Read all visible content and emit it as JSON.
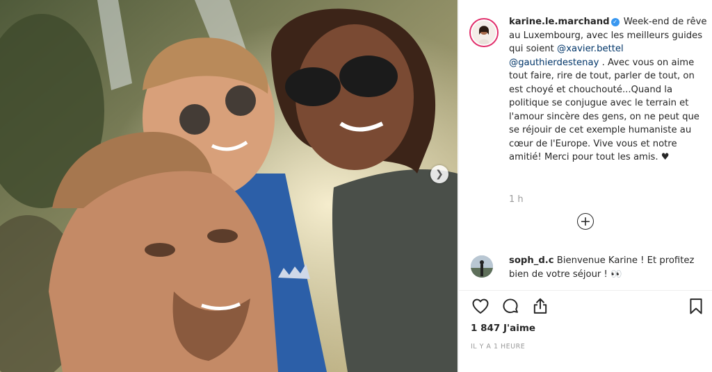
{
  "post": {
    "username": "karine.le.marchand",
    "caption_start": " Week-end de rêve au Luxembourg, avec les meilleurs guides qui soient ",
    "mention_1": "@xavier.bettel",
    "mention_2": "@gauthierdestenay",
    "caption_end": " . Avec vous on aime tout faire, rire de tout, parler de tout, on est choyé et chouchouté...Quand la politique se conjugue avec le terrain et l'amour sincère des gens, on ne peut que se réjouir de cet exemple humaniste au cœur de l'Europe. Vive vous et notre amitié! Merci pour tout les amis. ♥",
    "caption_time": "1 h",
    "likes": "1 847 J'aime",
    "posted_ago": "IL Y A 1 HEURE"
  },
  "comment": {
    "username": "soph_d.c",
    "text": " Bienvenue Karine ! Et profitez bien de votre séjour ! 👀"
  },
  "icons": {
    "verified": "verified-badge-icon",
    "load_more": "plus-circle-icon",
    "like": "heart-icon",
    "comment": "comment-bubble-icon",
    "share": "share-icon",
    "save": "bookmark-icon",
    "next": "chevron-right-icon"
  },
  "colors": {
    "mention": "#003569",
    "verified": "#3897f0",
    "story_ring": "#e1306c",
    "muted": "#999999"
  }
}
